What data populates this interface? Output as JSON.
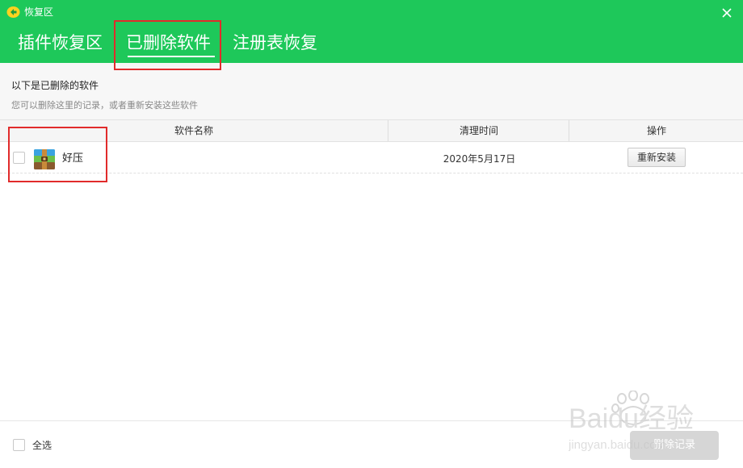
{
  "window": {
    "title": "恢复区",
    "icon": "recovery-app-icon",
    "close_icon": "close-icon"
  },
  "tabs": [
    {
      "label": "插件恢复区",
      "active": false
    },
    {
      "label": "已删除软件",
      "active": true
    },
    {
      "label": "注册表恢复",
      "active": false
    }
  ],
  "intro": {
    "title": "以下是已删除的软件",
    "subtitle": "您可以删除这里的记录，或者重新安装这些软件"
  },
  "table": {
    "columns": [
      "软件名称",
      "清理时间",
      "操作"
    ],
    "rows": [
      {
        "name": "好压",
        "date": "2020年5月17日",
        "action": "重新安装",
        "icon": "haozip-archive-icon",
        "checked": false
      }
    ]
  },
  "footer": {
    "select_all_label": "全选",
    "action_label": "删除记录"
  },
  "watermark": {
    "brand": "Baidu经验",
    "url": "jingyan.baidu.com"
  },
  "colors": {
    "header_green": "#1ec85a",
    "highlight_red": "#e12b2b",
    "disabled_button": "#d6d6d6"
  }
}
